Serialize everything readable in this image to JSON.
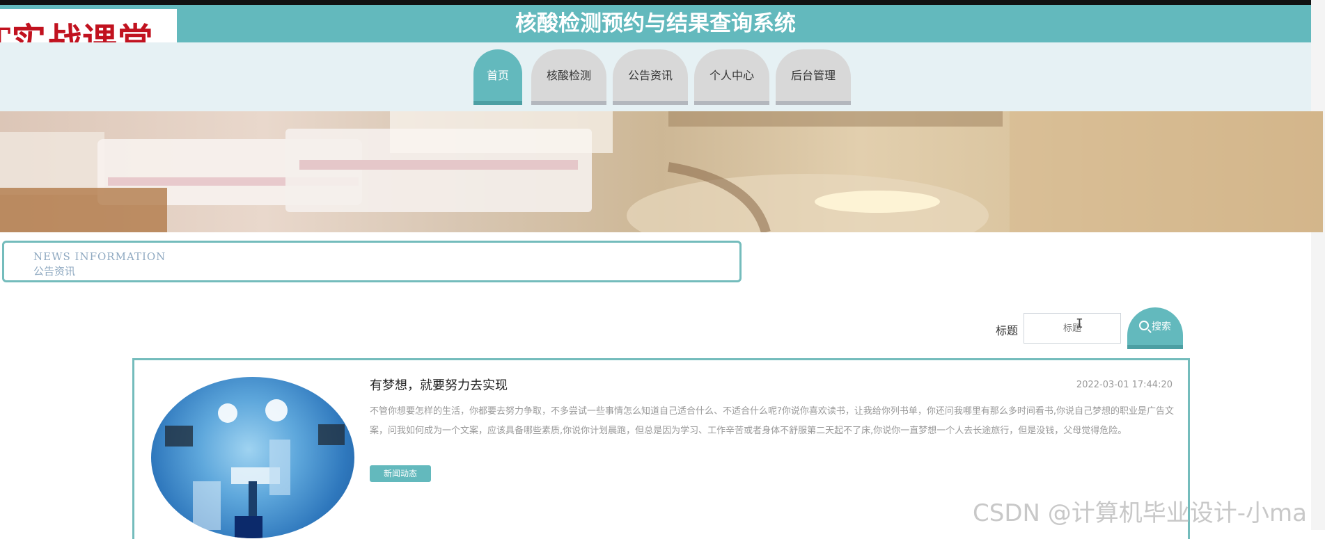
{
  "logo": {
    "text": "T实战课堂"
  },
  "header": {
    "title": "核酸检测预约与结果查询系统"
  },
  "nav": {
    "items": [
      {
        "label": "首页",
        "active": true
      },
      {
        "label": "核酸检测",
        "active": false
      },
      {
        "label": "公告资讯",
        "active": false
      },
      {
        "label": "个人中心",
        "active": false
      },
      {
        "label": "后台管理",
        "active": false
      }
    ]
  },
  "section": {
    "title_en": "NEWS  INFORMATION",
    "title_cn": "公告资讯"
  },
  "search": {
    "label": "标题",
    "placeholder": "标题",
    "button_label": "搜索"
  },
  "articles": [
    {
      "title": "有梦想，就要努力去实现",
      "date": "2022-03-01 17:44:20",
      "summary": "不管你想要怎样的生活，你都要去努力争取，不多尝试一些事情怎么知道自己适合什么、不适合什么呢?你说你喜欢读书，让我给你列书单，你还问我哪里有那么多时间看书,你说自己梦想的职业是广告文案，问我如何成为一个文案，应该具备哪些素质,你说你计划晨跑，但总是因为学习、工作辛苦或者身体不舒服第二天起不了床,你说你一直梦想一个人去长途旅行，但是没钱，父母觉得危险。",
      "tag": "新闻动态"
    }
  ],
  "watermark": "CSDN @计算机毕业设计-小ma",
  "colors": {
    "accent": "#63b9bd",
    "border": "#74bcbc",
    "nav_bg": "#e6f1f4"
  }
}
